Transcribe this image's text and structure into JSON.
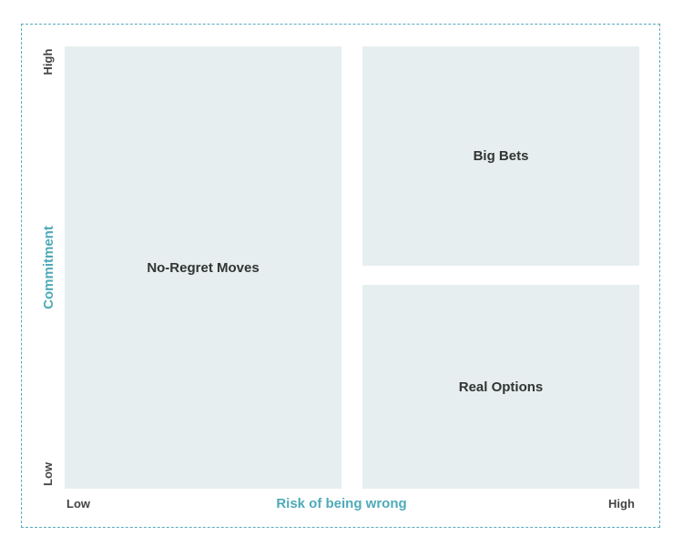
{
  "colors": {
    "quadrant_fill": "#e6eeef",
    "axis_title": "#4eaab9",
    "frame_border": "#5aaabd",
    "label_text": "#333333"
  },
  "quadrants": {
    "no_regret": "No-Regret Moves",
    "big_bets": "Big Bets",
    "real_options": "Real Options"
  },
  "x_axis": {
    "title": "Risk of being wrong",
    "low": "Low",
    "high": "High"
  },
  "y_axis": {
    "title": "Commitment",
    "low": "Low",
    "high": "High"
  }
}
